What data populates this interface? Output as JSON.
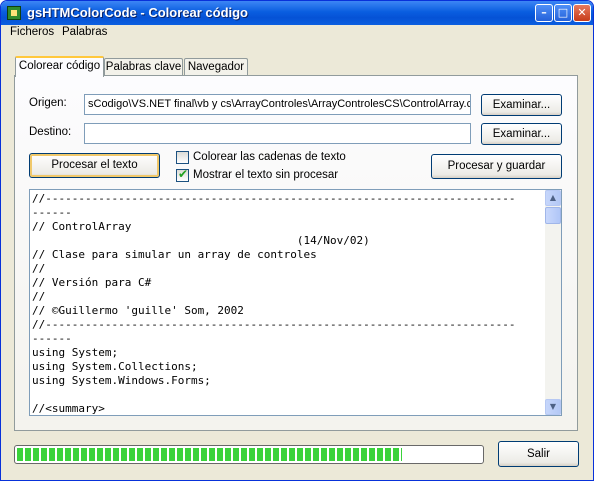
{
  "window": {
    "title": "gsHTMColorCode - Colorear código"
  },
  "title_buttons": {
    "minimize": "–",
    "maximize": "□",
    "close": "✕"
  },
  "menu": {
    "items": [
      "Ficheros",
      "Palabras"
    ]
  },
  "tabs": [
    {
      "label": "Colorear código",
      "active": true
    },
    {
      "label": "Palabras clave",
      "active": false
    },
    {
      "label": "Navegador",
      "active": false
    }
  ],
  "form": {
    "origen_label": "Origen:",
    "origen_value": "sCodigo\\VS.NET final\\vb y cs\\ArrayControles\\ArrayControlesCS\\ControlArray.cs",
    "destino_label": "Destino:",
    "destino_value": "",
    "examinar_label": "Examinar..."
  },
  "actions": {
    "procesar_label": "Procesar el texto",
    "procesar_guardar_label": "Procesar y guardar"
  },
  "options": {
    "colorear_cadenas": {
      "label": "Colorear las cadenas de texto",
      "checked": false
    },
    "mostrar_sin_procesar": {
      "label": "Mostrar el texto sin procesar",
      "checked": true
    }
  },
  "code": {
    "lines": [
      "//-----------------------------------------------------------------------",
      "------",
      "// ControlArray",
      "                                        (14/Nov/02)",
      "// Clase para simular un array de controles",
      "//",
      "// Versión para C#",
      "//",
      "// ©Guillermo 'guille' Som, 2002",
      "//-----------------------------------------------------------------------",
      "------",
      "using System;",
      "using System.Collections;",
      "using System.Windows.Forms;",
      "",
      "//<summary>"
    ]
  },
  "progress": {
    "fraction": 0.83
  },
  "footer": {
    "salir_label": "Salir"
  },
  "colors": {
    "titlebar": "#0a5ee0",
    "progress": "#3ad23a",
    "check": "#21a121"
  }
}
